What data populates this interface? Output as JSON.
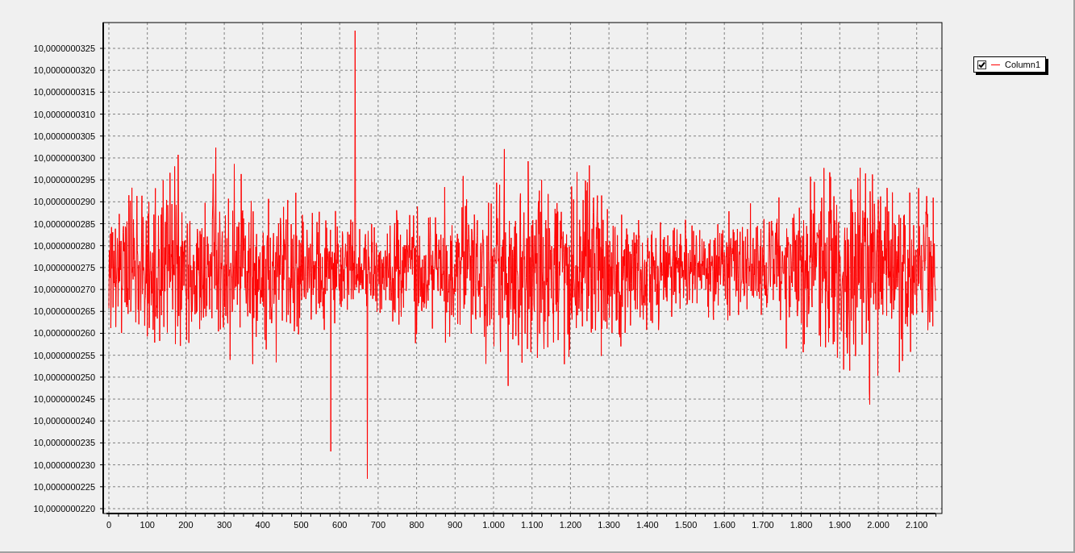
{
  "chart": {
    "y_tick_labels": [
      "10,0000000325",
      "10,0000000320",
      "10,0000000315",
      "10,0000000310",
      "10,0000000305",
      "10,0000000300",
      "10,0000000295",
      "10,0000000290",
      "10,0000000285",
      "10,0000000280",
      "10,0000000275",
      "10,0000000270",
      "10,0000000265",
      "10,0000000260",
      "10,0000000255",
      "10,0000000250",
      "10,0000000245",
      "10,0000000240",
      "10,0000000235",
      "10,0000000230",
      "10,0000000225",
      "10,0000000220"
    ],
    "x_tick_labels": [
      "0",
      "100",
      "200",
      "300",
      "400",
      "500",
      "600",
      "700",
      "800",
      "900",
      "1.000",
      "1.100",
      "1.200",
      "1.300",
      "1.400",
      "1.500",
      "1.600",
      "1.700",
      "1.800",
      "1.900",
      "2.000",
      "2.100"
    ]
  },
  "legend": {
    "items": [
      {
        "label": "Column1",
        "checked": true,
        "color": "#ff0000"
      }
    ]
  }
}
